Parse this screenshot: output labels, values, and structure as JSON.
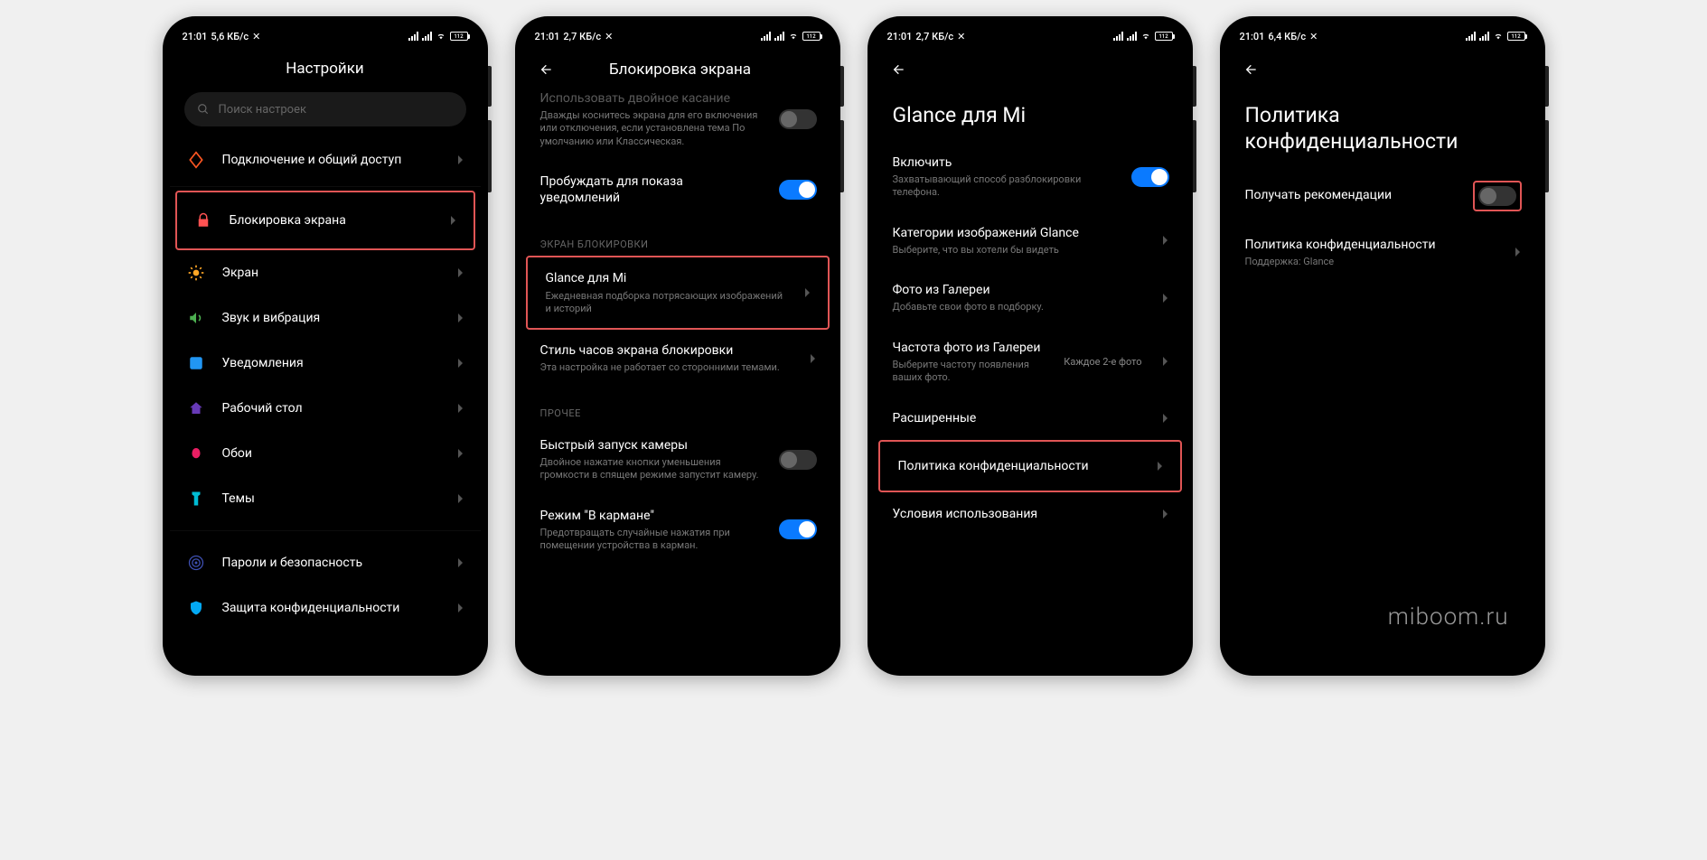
{
  "status": {
    "time": "21:01",
    "speed1": "5,6 КБ/с",
    "speed2": "2,7 КБ/с",
    "speed3": "2,7 КБ/с",
    "speed4": "6,4 КБ/с",
    "battery": "112"
  },
  "screen1": {
    "title": "Настройки",
    "search_placeholder": "Поиск настроек",
    "items": {
      "connection": "Подключение и общий доступ",
      "lockscreen": "Блокировка экрана",
      "display": "Экран",
      "sound": "Звук и вибрация",
      "notifications": "Уведомления",
      "home": "Рабочий стол",
      "wallpaper": "Обои",
      "themes": "Темы",
      "passwords": "Пароли и безопасность",
      "privacy": "Защита конфиденциальности"
    }
  },
  "screen2": {
    "title": "Блокировка экрана",
    "truncated_title": "Использовать двойное касание",
    "truncated_sub": "Дважды коснитесь экрана для его включения или отключения, если установлена тема По умолчанию или Классическая.",
    "wake_title": "Пробуждать для показа уведомлений",
    "section_lock": "ЭКРАН БЛОКИРОВКИ",
    "glance_title": "Glance для Mi",
    "glance_sub": "Ежедневная подборка потрясающих изображений и историй",
    "clock_title": "Стиль часов экрана блокировки",
    "clock_sub": "Эта настройка не работает со сторонними темами.",
    "section_other": "ПРОЧЕЕ",
    "camera_title": "Быстрый запуск камеры",
    "camera_sub": "Двойное нажатие кнопки уменьшения громкости в спящем режиме запустит камеру.",
    "pocket_title": "Режим \"В кармане\"",
    "pocket_sub": "Предотвращать случайные нажатия при помещении устройства в карман."
  },
  "screen3": {
    "title": "Glance для Mi",
    "enable_title": "Включить",
    "enable_sub": "Захватывающий способ разблокировки телефона.",
    "categories_title": "Категории изображений Glance",
    "categories_sub": "Выберите, что вы хотели бы видеть",
    "gallery_title": "Фото из Галереи",
    "gallery_sub": "Добавьте свои фото в подборку.",
    "freq_title": "Частота фото из Галереи",
    "freq_sub": "Выберите частоту появления ваших фото.",
    "freq_value": "Каждое 2-е фото",
    "advanced": "Расширенные",
    "privacy": "Политика конфиденциальности",
    "terms": "Условия использования"
  },
  "screen4": {
    "title": "Политика конфиденциальности",
    "recommendations": "Получать рекомендации",
    "privacy_title": "Политика конфиденциальности",
    "privacy_sub": "Поддержка: Glance"
  },
  "watermark": "miboom.ru"
}
